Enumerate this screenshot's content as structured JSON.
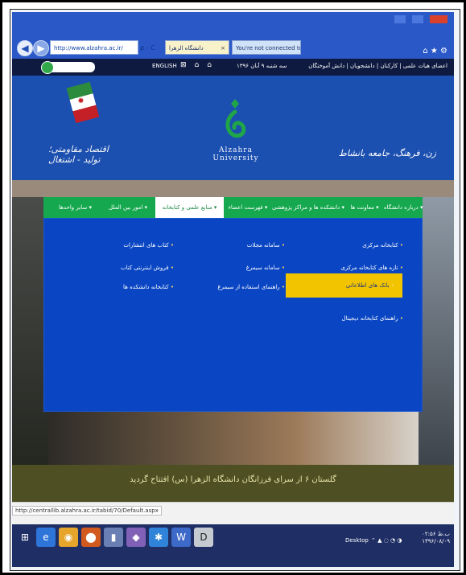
{
  "browser": {
    "address_url": "http://www.alzahra.ac.ir/",
    "search_hint": "ρ - C",
    "tabs": [
      {
        "label": "دانشگاه الزهرا"
      },
      {
        "label": "You're not connected to a net..."
      }
    ],
    "status_url": "http://centrallib.alzahra.ac.ir/tabid/70/Default.aspx"
  },
  "site": {
    "topbar": {
      "english": "ENGLISH",
      "date": "سه شنبه ۹ آبان ۱۳۹۶",
      "links": "اعضای هیات علمی | کارکنان | دانشجویان | دانش آموختگان"
    },
    "banner": {
      "left_caption": "اقتصاد مقاومتی؛ تولید - اشتغال",
      "logo_text": "Alzahra University",
      "right_caption": "زن، فرهنگ، جامعه بانشاط"
    },
    "nav": {
      "items": [
        {
          "label": "سایر واحدها ▾"
        },
        {
          "label": "امور بین الملل ▾"
        },
        {
          "label": "منابع علمی و کتابخانه ▾"
        },
        {
          "label": "فهرست اعضاء ▾"
        },
        {
          "label": "دانشکده ها و مراکز پژوهشی ▾"
        },
        {
          "label": "معاونت ها ▾"
        },
        {
          "label": "درباره دانشگاه ▾"
        }
      ]
    },
    "mega": {
      "col1": [
        "کتابخانه مرکزی",
        "تازه های کتابخانه مرکزی",
        "بانک های اطلاعاتی",
        "راهنمای کتابخانه دیجیتال"
      ],
      "col2": [
        "سامانه مجلات",
        "سامانه سیمرغ",
        "راهنمای استفاده از سیمرغ"
      ],
      "col3": [
        "کتاب های انتشارات",
        "فروش اینترنتی کتاب",
        "کتابخانه دانشکده ها"
      ]
    },
    "news": "گلستان ۶ از سرای فرزانگان دانشگاه الزهرا (س) افتتاح گردید"
  },
  "taskbar": {
    "desktop": "Desktop",
    "time": "۰۲:۵۶ ب.ظ",
    "date": "۱۳۹۶/۰۸/۰۹"
  }
}
